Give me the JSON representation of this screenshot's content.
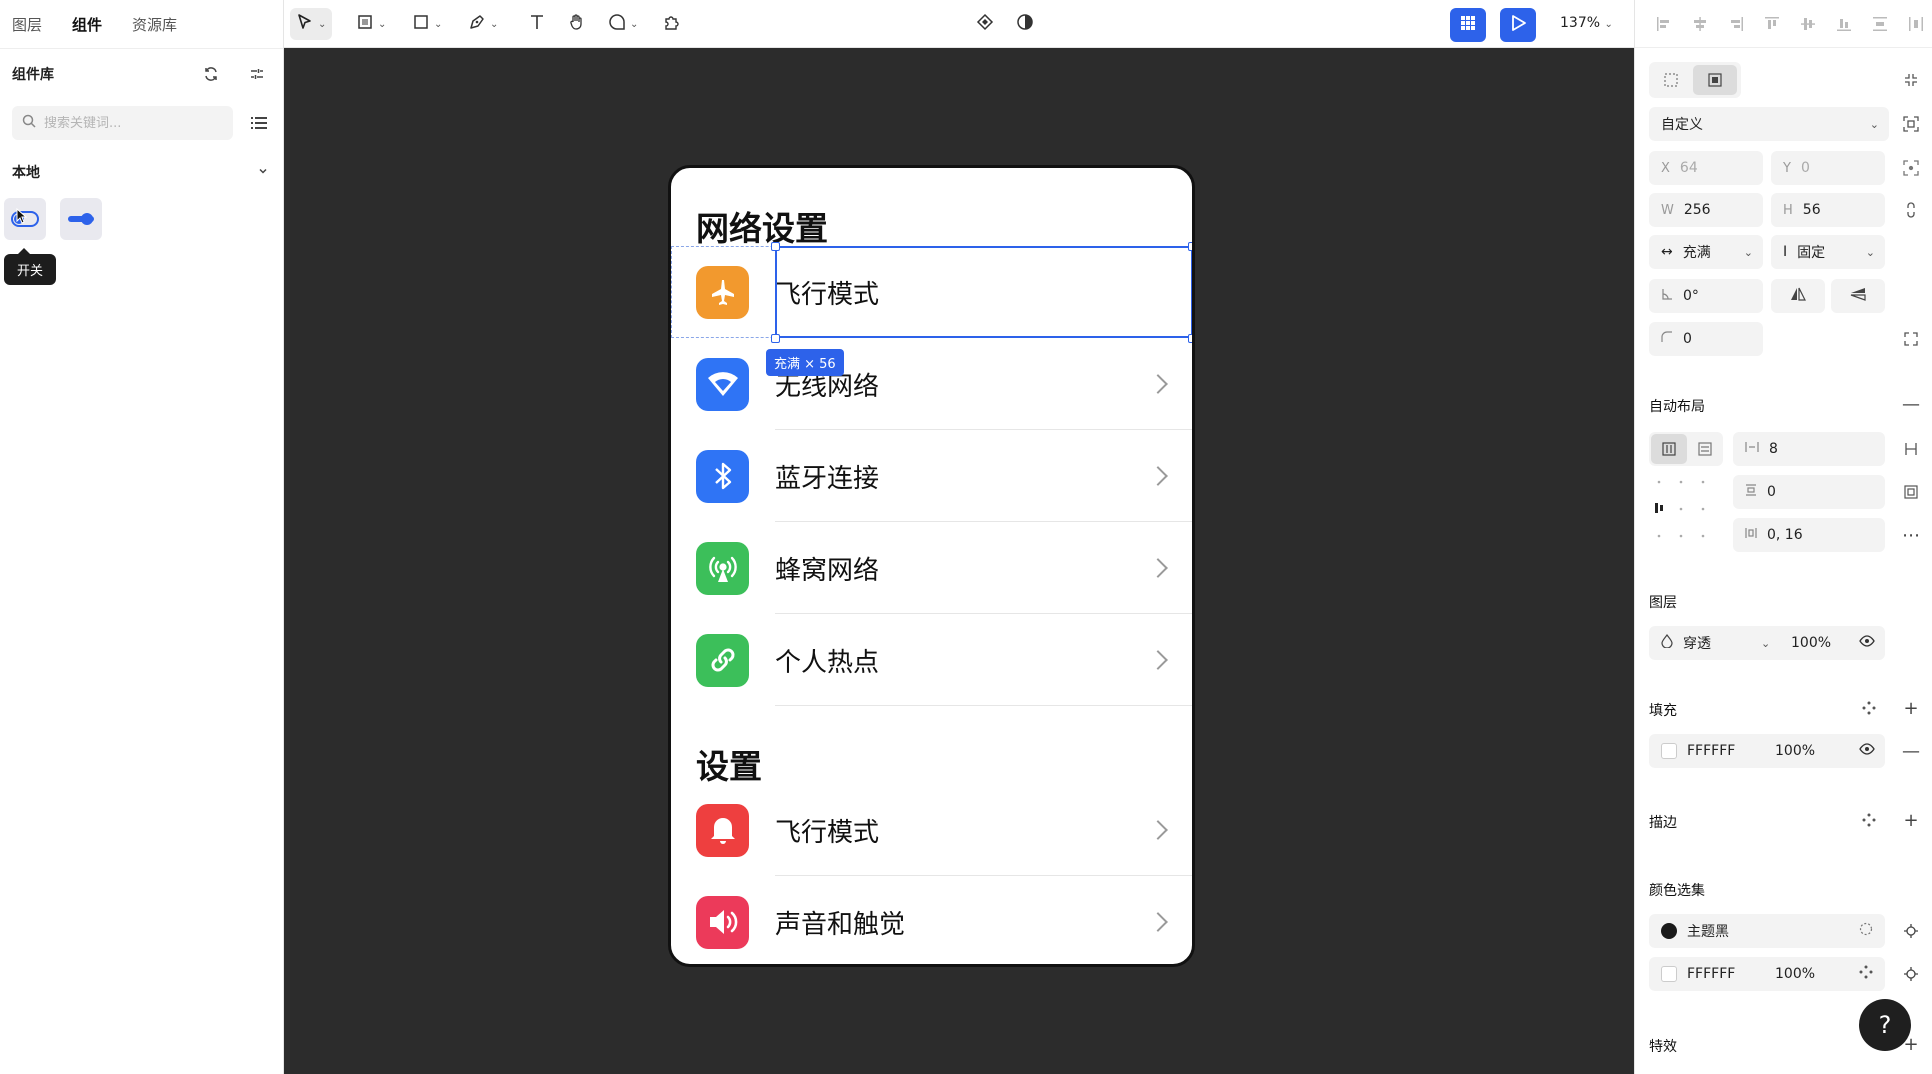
{
  "left_panel": {
    "tabs": [
      "图层",
      "组件",
      "资源库"
    ],
    "active_tab": "组件",
    "library_title": "组件库",
    "search_placeholder": "搜索关键词...",
    "local_title": "本地",
    "tooltip": "开关"
  },
  "toolbar": {
    "zoom": "137%"
  },
  "canvas": {
    "section1_title": "网络设置",
    "section2_title": "设置",
    "rows": [
      {
        "label": "飞行模式",
        "icon": "airplane-icon",
        "color": "#f2992e"
      },
      {
        "label": "无线网络",
        "icon": "wifi-icon",
        "color": "#2f74f5"
      },
      {
        "label": "蓝牙连接",
        "icon": "bluetooth-icon",
        "color": "#2f74f5"
      },
      {
        "label": "蜂窝网络",
        "icon": "cellular-icon",
        "color": "#3cbf5a"
      },
      {
        "label": "个人热点",
        "icon": "hotspot-icon",
        "color": "#3cbf5a"
      },
      {
        "label": "飞行模式",
        "icon": "bell-icon",
        "color": "#ee3f3f"
      },
      {
        "label": "声音和触觉",
        "icon": "speaker-icon",
        "color": "#ec3a5a"
      }
    ],
    "size_badge": "充满 × 56"
  },
  "right_panel": {
    "frame_preset": "自定义",
    "x_label": "X",
    "x": "64",
    "y_label": "Y",
    "y": "0",
    "w_label": "W",
    "w": "256",
    "h_label": "H",
    "h": "56",
    "width_mode": "充满",
    "height_mode": "固定",
    "rotation": "0°",
    "radius": "0",
    "auto_layout_title": "自动布局",
    "gap": "8",
    "padding_v": "0",
    "padding_h": "0, 16",
    "layer_title": "图层",
    "blend_mode": "穿透",
    "layer_opacity": "100%",
    "fill_title": "填充",
    "fill_hex": "FFFFFF",
    "fill_opacity": "100%",
    "stroke_title": "描边",
    "selection_colors_title": "颜色选集",
    "sel_color1": "主题黑",
    "sel_color2_hex": "FFFFFF",
    "sel_color2_opacity": "100%",
    "effects_title": "特效",
    "help": "?"
  }
}
